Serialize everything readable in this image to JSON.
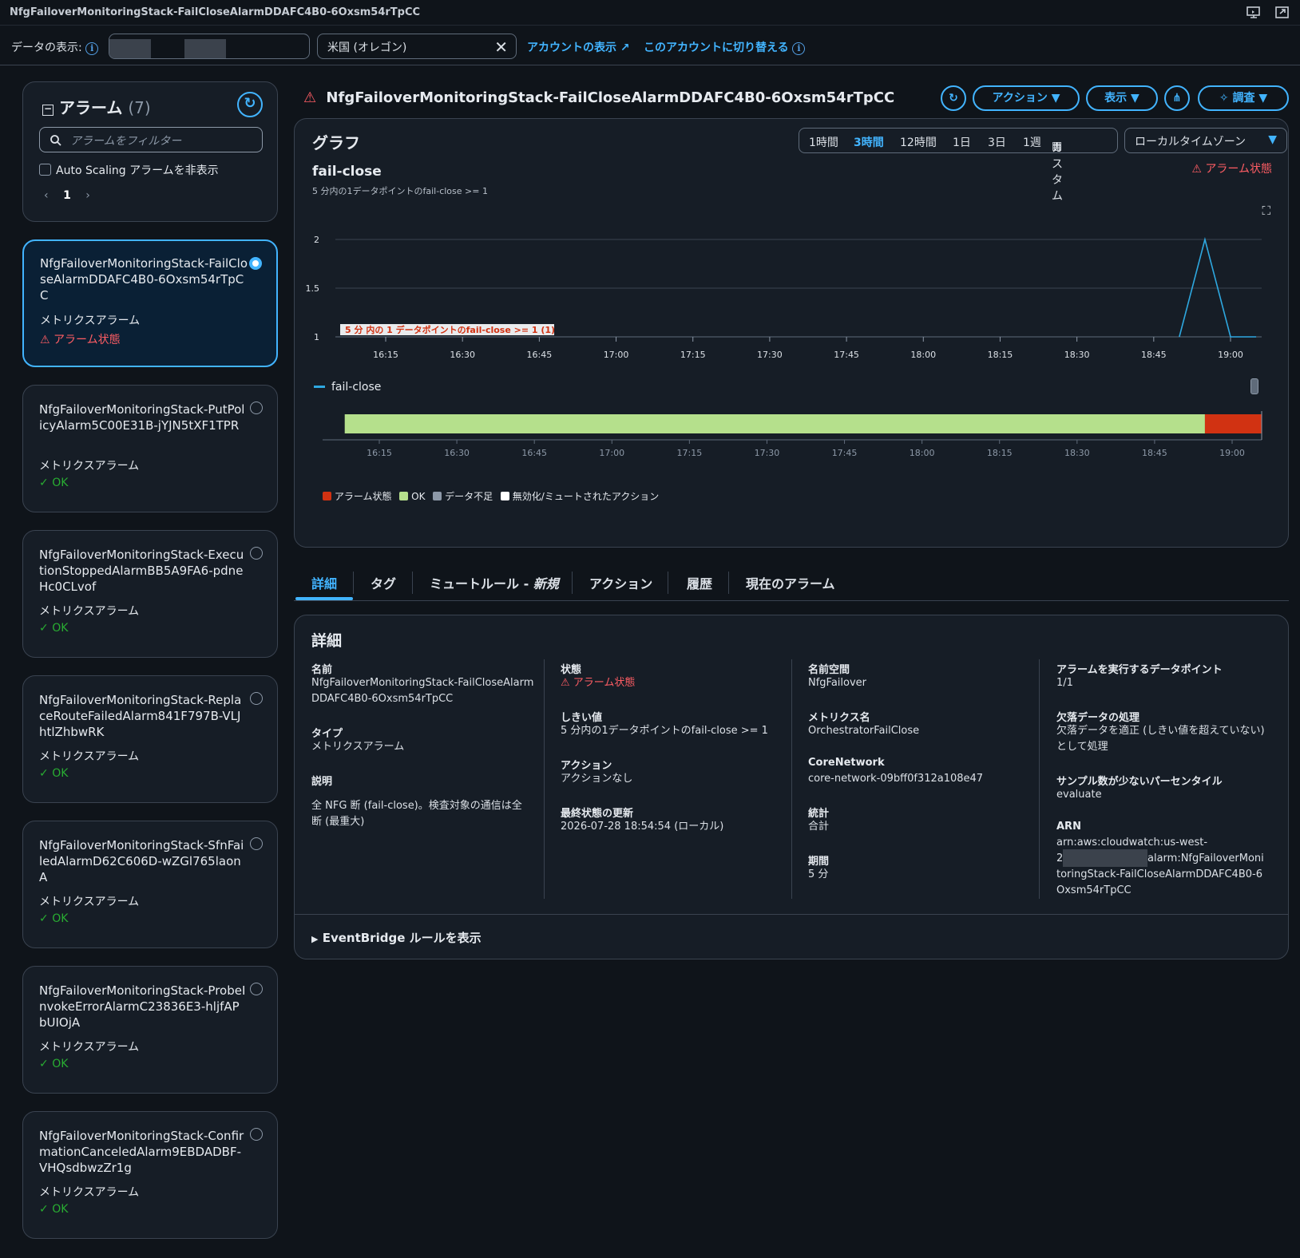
{
  "window": {
    "title": "NfgFailoverMonitoringStack-FailCloseAlarmDDAFC4B0-6Oxsm54rTpCC"
  },
  "topbar": {
    "view_label": "データの表示:",
    "region": "米国 (オレゴン)",
    "view_account": "アカウントの表示",
    "switch_account": "このアカウントに切り替える"
  },
  "sidebar": {
    "title": "アラーム",
    "count": "(7)",
    "filter_placeholder": "アラームをフィルター",
    "hide_autoscaling": "Auto Scaling アラームを非表示",
    "page": "1",
    "alarms": [
      {
        "name": "NfgFailoverMonitoringStack-FailCloseAlarmDDAFC4B0-6Oxsm54rTpCC",
        "type": "メトリクスアラーム",
        "state": "アラーム状態",
        "selected": true
      },
      {
        "name": "NfgFailoverMonitoringStack-PutPolicyAlarm5C00E31B-jYJN5tXF1TPR",
        "type": "メトリクスアラーム",
        "state": "OK",
        "selected": false
      },
      {
        "name": "NfgFailoverMonitoringStack-ExecutionStoppedAlarmBB5A9FA6-pdneHc0CLvof",
        "type": "メトリクスアラーム",
        "state": "OK",
        "selected": false
      },
      {
        "name": "NfgFailoverMonitoringStack-ReplaceRouteFailedAlarm841F797B-VLJhtlZhbwRK",
        "type": "メトリクスアラーム",
        "state": "OK",
        "selected": false
      },
      {
        "name": "NfgFailoverMonitoringStack-SfnFailedAlarmD62C606D-wZGl765laonA",
        "type": "メトリクスアラーム",
        "state": "OK",
        "selected": false
      },
      {
        "name": "NfgFailoverMonitoringStack-ProbeInvokeErrorAlarmC23836E3-hljfAPbUIOjA",
        "type": "メトリクスアラーム",
        "state": "OK",
        "selected": false
      },
      {
        "name": "NfgFailoverMonitoringStack-ConfirmationCanceledAlarm9EBDADBF-VHQsdbwzZr1g",
        "type": "メトリクスアラーム",
        "state": "OK",
        "selected": false
      }
    ]
  },
  "header": {
    "alarm_name": "NfgFailoverMonitoringStack-FailCloseAlarmDDAFC4B0-6Oxsm54rTpCC",
    "actions": "アクション",
    "view": "表示",
    "investigate": "調査"
  },
  "graph": {
    "title": "グラフ",
    "ranges": [
      "1時間",
      "3時間",
      "12時間",
      "1日",
      "3日",
      "1週"
    ],
    "active_range": "3時間",
    "custom": "カスタム",
    "timezone": "ローカルタイムゾーン",
    "state": "アラーム状態",
    "metric": "fail-close",
    "subtitle": "5 分内の1データポイントのfail-close >= 1",
    "legend": "fail-close",
    "threshold_label": "5 分 内の 1 データポイントのfail-close >= 1 (1)",
    "state_legend": [
      "アラーム状態",
      "OK",
      "データ不足",
      "無効化/ミュートされたアクション"
    ]
  },
  "chart_data": {
    "type": "line",
    "x": [
      "16:15",
      "16:30",
      "16:45",
      "17:00",
      "17:15",
      "17:30",
      "17:45",
      "18:00",
      "18:15",
      "18:30",
      "18:45",
      "19:00"
    ],
    "y_ticks": [
      1,
      1.5,
      2
    ],
    "ylim": [
      1,
      2
    ],
    "threshold": 1,
    "series": [
      {
        "name": "fail-close",
        "color": "#2ea8e0",
        "points": [
          [
            "18:50",
            1
          ],
          [
            "18:55",
            2
          ],
          [
            "19:00",
            1
          ],
          [
            "19:05",
            1
          ]
        ]
      }
    ],
    "state_timeline": [
      {
        "state": "OK",
        "from": "16:07",
        "to": "18:55",
        "color": "#b5e08c"
      },
      {
        "state": "アラーム状態",
        "from": "18:55",
        "to": "19:06",
        "color": "#d13212"
      }
    ]
  },
  "tabs": {
    "items": [
      "詳細",
      "タグ",
      "ミュートルール - ",
      "アクション",
      "履歴",
      "現在のアラーム"
    ],
    "new_badge": "新規",
    "active": "詳細"
  },
  "details": {
    "title": "詳細",
    "name_k": "名前",
    "name_v": "NfgFailoverMonitoringStack-FailCloseAlarmDDAFC4B0-6Oxsm54rTpCC",
    "type_k": "タイプ",
    "type_v": "メトリクスアラーム",
    "desc_k": "説明",
    "desc_v": "全 NFG 断 (fail-close)。検査対象の通信は全断 (最重大)",
    "state_k": "状態",
    "state_v": "アラーム状態",
    "threshold_k": "しきい値",
    "threshold_v": "5 分内の1データポイントのfail-close >= 1",
    "action_k": "アクション",
    "action_v": "アクションなし",
    "updated_k": "最終状態の更新",
    "updated_v": "2026-07-28 18:54:54 (ローカル)",
    "ns_k": "名前空間",
    "ns_v": "NfgFailover",
    "metric_k": "メトリクス名",
    "metric_v": "OrchestratorFailClose",
    "cn_k": "CoreNetwork",
    "cn_v": "core-network-09bff0f312a108e47",
    "stat_k": "統計",
    "stat_v": "合計",
    "period_k": "期間",
    "period_v": "5 分",
    "dp_k": "アラームを実行するデータポイント",
    "dp_v": "1/1",
    "missing_k": "欠落データの処理",
    "missing_v": "欠落データを適正 (しきい値を超えていない)として処理",
    "pct_k": "サンプル数が少ないパーセンタイル",
    "pct_v": "evaluate",
    "arn_k": "ARN",
    "arn_v1": "arn:aws:cloudwatch:us-west-",
    "arn_v2": "2",
    "arn_v3": "alarm:NfgFailoverMonitoringStack-FailCloseAlarmDDAFC4B0-6Oxsm54rTpCC",
    "eventbridge": "EventBridge ルールを表示"
  }
}
